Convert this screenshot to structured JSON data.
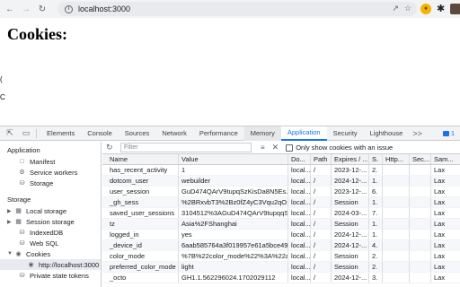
{
  "browser": {
    "url": "localhost:3000",
    "icons": {
      "back": "arrow-left-icon",
      "forward": "arrow-right-icon",
      "reload": "reload-icon",
      "info": "info-icon"
    }
  },
  "page": {
    "title": "Cookies:",
    "frag1": "(",
    "frag2": "C"
  },
  "devtools": {
    "tabs": [
      "Elements",
      "Console",
      "Sources",
      "Network",
      "Performance",
      "Memory",
      "Application",
      "Security",
      "Lighthouse"
    ],
    "active_tab": "Application",
    "more": ">>",
    "message_count": "1"
  },
  "sidebar": {
    "application_heading": "Application",
    "application_items": [
      "Manifest",
      "Service workers",
      "Storage"
    ],
    "storage_heading": "Storage",
    "storage_items": [
      "Local storage",
      "Session storage",
      "IndexedDB",
      "Web SQL",
      "Cookies"
    ],
    "cookie_origin": "http://localhost:3000",
    "private_state": "Private state tokens"
  },
  "filter": {
    "placeholder": "Filter",
    "only_issues_label": "Only show cookies with an issue"
  },
  "table": {
    "columns": [
      "Name",
      "Value",
      "Do...",
      "Path",
      "Expires / ...",
      "S.",
      "Http...",
      "Sec...",
      "Sam..."
    ],
    "rows": [
      [
        "has_recent_activity",
        "1",
        "local...",
        "/",
        "2023-12-...",
        "2.",
        "",
        "",
        "Lax"
      ],
      [
        "dotcom_user",
        "webuilder",
        "local...",
        "/",
        "2024-12-...",
        "1.",
        "",
        "",
        "Lax"
      ],
      [
        "user_session",
        "GuD474QArV9tupqSzKisDa8N5Es...",
        "local...",
        "/",
        "2023-12-...",
        "6.",
        "",
        "",
        "Lax"
      ],
      [
        "_gh_sess",
        "%2BRxvbT3%2Bz0fZ4yC3Vqu2qO...",
        "local...",
        "/",
        "Session",
        "1.",
        "",
        "",
        "Lax"
      ],
      [
        "saved_user_sessions",
        "3104512%3AGuD474QArV9tupqqS...",
        "local...",
        "/",
        "2024-03-...",
        "7.",
        "",
        "",
        "Lax"
      ],
      [
        "tz",
        "Asia%2FShanghai",
        "local...",
        "/",
        "Session",
        "1.",
        "",
        "",
        "Lax"
      ],
      [
        "logged_in",
        "yes",
        "local...",
        "/",
        "2024-12-...",
        "1.",
        "",
        "",
        "Lax"
      ],
      [
        "_device_id",
        "6aab585764a3f019957e61a5bce49...",
        "local...",
        "/",
        "2024-12-...",
        "4.",
        "",
        "",
        "Lax"
      ],
      [
        "color_mode",
        "%7B%22color_mode%22%3A%22a...",
        "local...",
        "/",
        "Session",
        "2.",
        "",
        "",
        "Lax"
      ],
      [
        "preferred_color_mode",
        "light",
        "local...",
        "/",
        "Session",
        "2.",
        "",
        "",
        "Lax"
      ],
      [
        "_octo",
        "GH1.1.562296024.1702029112",
        "local...",
        "/",
        "2024-12-...",
        "3.",
        "",
        "",
        "Lax"
      ]
    ]
  }
}
